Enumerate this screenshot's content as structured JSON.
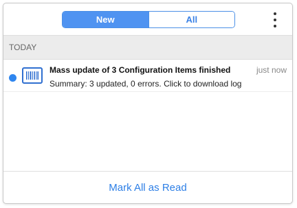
{
  "tabs": {
    "new_label": "New",
    "all_label": "All",
    "selected": "New"
  },
  "menu": {
    "icon": "more-vertical-icon"
  },
  "section": {
    "label": "TODAY"
  },
  "notifications": [
    {
      "unread": true,
      "icon": "barcode-icon",
      "title": "Mass update of 3 Configuration Items finished",
      "summary": "Summary: 3 updated, 0 errors. Click to download log",
      "time": "just now"
    }
  ],
  "footer": {
    "mark_all_label": "Mark All as Read"
  },
  "colors": {
    "accent": "#4f93f1",
    "unread_dot": "#2f86ef",
    "link": "#2d7fe6"
  }
}
